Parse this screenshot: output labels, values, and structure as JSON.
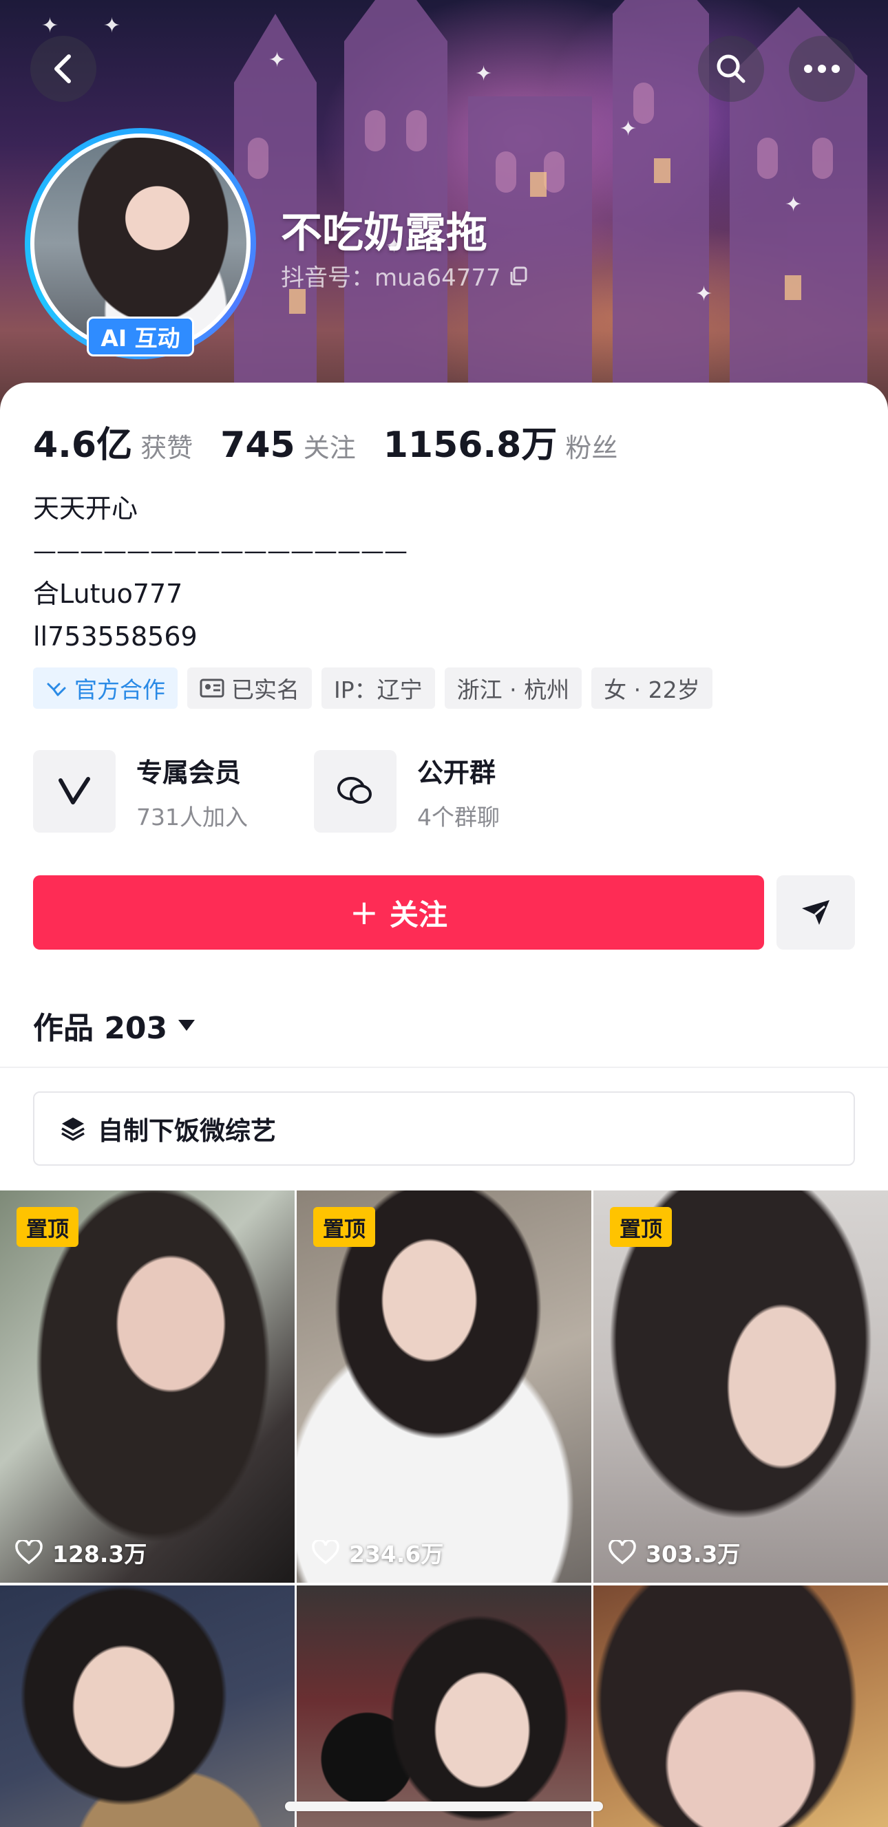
{
  "header": {
    "nickname": "不吃奶露拖",
    "douyin_id": "抖音号：mua64777",
    "ai_badge": "AI 互动"
  },
  "stats": [
    {
      "value": "4.6亿",
      "label": "获赞"
    },
    {
      "value": "745",
      "label": "关注"
    },
    {
      "value": "1156.8万",
      "label": "粉丝"
    }
  ],
  "bio": {
    "line1": "天天开心",
    "line2": "————————————————",
    "line3": "合Lutuo777",
    "line4": "ll753558569"
  },
  "tags": {
    "official": "官方合作",
    "verified": "已实名",
    "ip": "IP：辽宁",
    "location": "浙江 · 杭州",
    "gender_age": "女 · 22岁"
  },
  "entries": {
    "member_title": "专属会员",
    "member_sub": "731人加入",
    "group_title": "公开群",
    "group_sub": "4个群聊"
  },
  "actions": {
    "follow": "关注",
    "follow_plus": "+"
  },
  "works": {
    "title": "作品 203"
  },
  "collection": {
    "label": "自制下饭微综艺"
  },
  "videos": [
    {
      "pin": "置顶",
      "likes": "128.3万"
    },
    {
      "pin": "置顶",
      "likes": "234.6万"
    },
    {
      "pin": "置顶",
      "likes": "303.3万"
    },
    {
      "pin": "",
      "likes": ""
    },
    {
      "pin": "",
      "likes": ""
    },
    {
      "pin": "",
      "likes": ""
    }
  ],
  "colors": {
    "follow_button": "#fe2c55",
    "pin_badge": "#ffc300",
    "ai_badge": "#2f8cff",
    "official_tag": "#2a8ae6"
  }
}
